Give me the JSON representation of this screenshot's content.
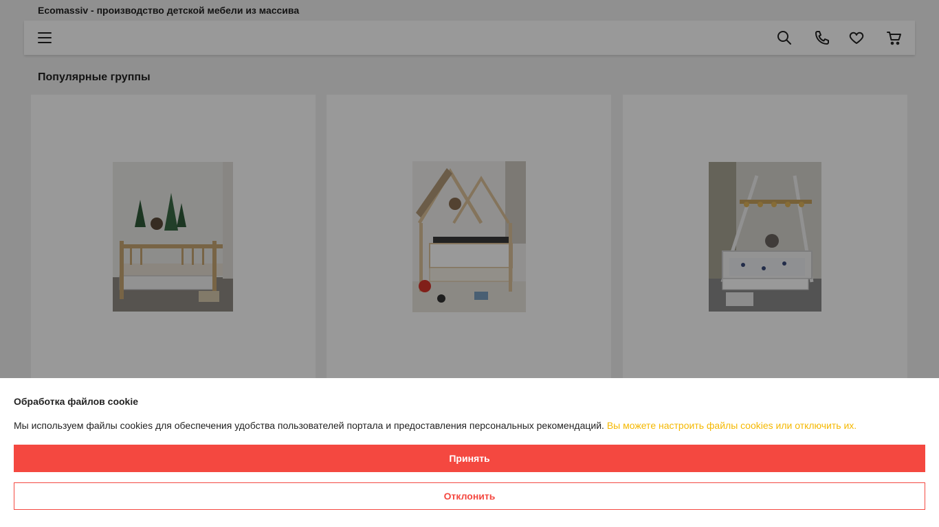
{
  "site": {
    "title": "Ecomassiv - производство детской мебели из массива"
  },
  "navbar": {
    "icons": [
      "menu-icon",
      "search-icon",
      "phone-icon",
      "heart-icon",
      "cart-icon"
    ]
  },
  "section": {
    "title": "Популярные группы"
  },
  "cards": [
    {
      "image": "bed-with-rails-photo"
    },
    {
      "image": "house-bed-photo"
    },
    {
      "image": "teepee-bed-photo"
    }
  ],
  "cookie": {
    "title": "Обработка файлов cookie",
    "text": "Мы используем файлы cookies для обеспечения удобства пользователей портала и предоставления персональных рекомендаций.",
    "link": "Вы можете настроить файлы cookies или отключить их.",
    "accept_label": "Принять",
    "decline_label": "Отклонить"
  },
  "colors": {
    "accent": "#f44840",
    "link": "#f5b800",
    "overlay": "rgba(0,0,0,0.4)"
  }
}
